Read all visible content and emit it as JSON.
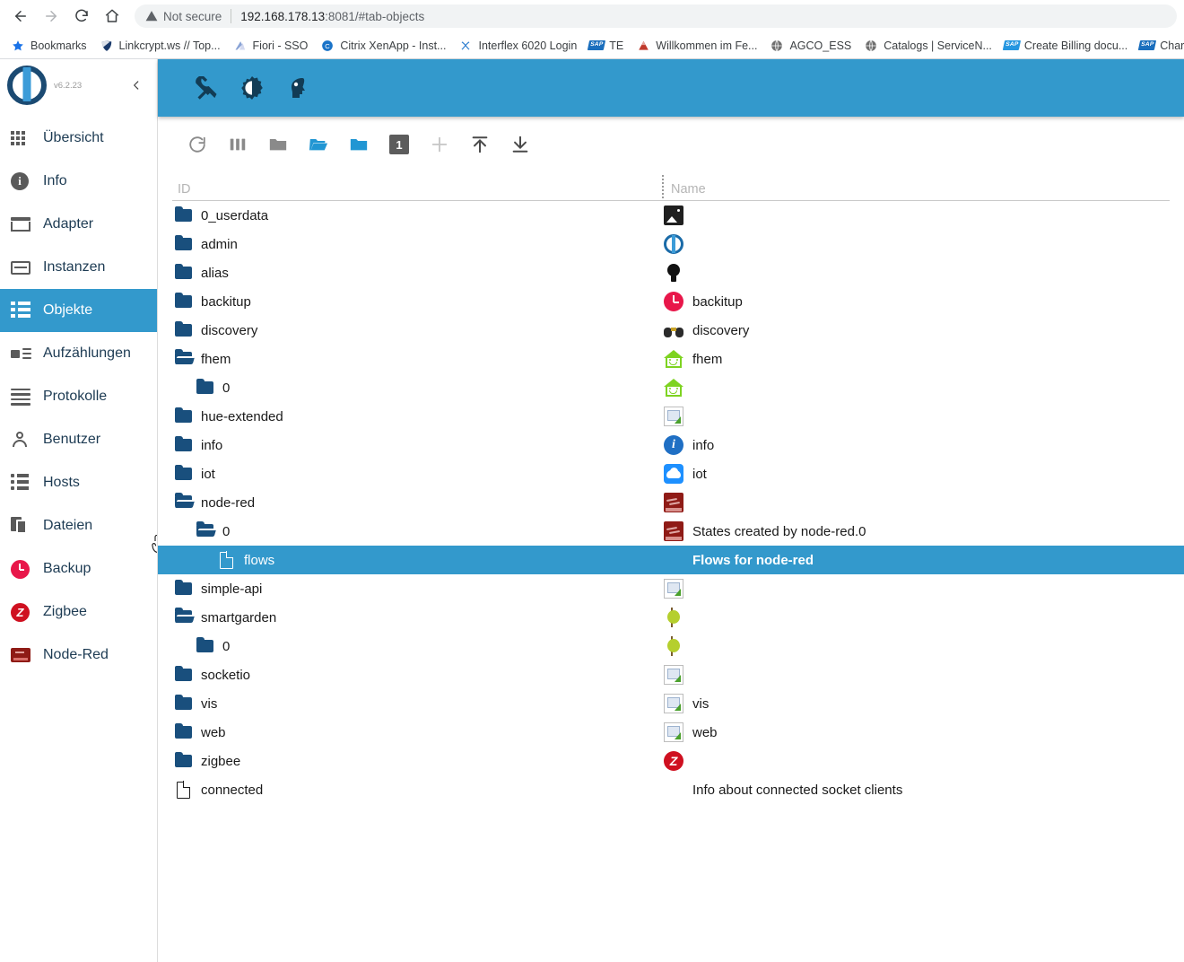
{
  "browser": {
    "nav": {
      "back": "←",
      "forward": "→",
      "reload": "↻",
      "home": "⌂"
    },
    "security_label": "Not secure",
    "url_host": "192.168.178.13",
    "url_rest": ":8081/#tab-objects",
    "bookmarks": [
      {
        "label": "Bookmarks",
        "icon": "star-icon"
      },
      {
        "label": "Linkcrypt.ws // Top...",
        "icon": "shield-icon"
      },
      {
        "label": "Fiori - SSO",
        "icon": "fiori-icon"
      },
      {
        "label": "Citrix XenApp - Inst...",
        "icon": "citrix-icon"
      },
      {
        "label": "Interflex 6020 Login",
        "icon": "interflex-icon"
      },
      {
        "label": "TE",
        "icon": "sap-icon"
      },
      {
        "label": "Willkommen im Fe...",
        "icon": "mountain-icon"
      },
      {
        "label": "AGCO_ESS",
        "icon": "globe-icon"
      },
      {
        "label": "Catalogs | ServiceN...",
        "icon": "globe-icon"
      },
      {
        "label": "Create Billing docu...",
        "icon": "sap-icon"
      },
      {
        "label": "Charm Lo",
        "icon": "sap-icon"
      }
    ]
  },
  "sidebar": {
    "version": "v6.2.23",
    "collapse_icon": "chevron-left-icon",
    "items": [
      {
        "label": "Übersicht",
        "icon": "grid-icon",
        "active": false
      },
      {
        "label": "Info",
        "icon": "info-icon",
        "active": false
      },
      {
        "label": "Adapter",
        "icon": "store-icon",
        "active": false
      },
      {
        "label": "Instanzen",
        "icon": "instance-icon",
        "active": false
      },
      {
        "label": "Objekte",
        "icon": "list-icon",
        "active": true
      },
      {
        "label": "Aufzählungen",
        "icon": "enum-icon",
        "active": false
      },
      {
        "label": "Protokolle",
        "icon": "log-icon",
        "active": false
      },
      {
        "label": "Benutzer",
        "icon": "user-icon",
        "active": false
      },
      {
        "label": "Hosts",
        "icon": "hosts-icon",
        "active": false
      },
      {
        "label": "Dateien",
        "icon": "files-icon",
        "active": false
      },
      {
        "label": "Backup",
        "icon": "backup-icon",
        "active": false
      },
      {
        "label": "Zigbee",
        "icon": "zigbee-icon",
        "active": false
      },
      {
        "label": "Node-Red",
        "icon": "nodered-icon",
        "active": false
      }
    ]
  },
  "app_header": {
    "background": "#3399cc",
    "icons": [
      {
        "name": "wrench-icon"
      },
      {
        "name": "contrast-icon"
      },
      {
        "name": "user-head-icon"
      }
    ]
  },
  "toolbar": {
    "buttons": [
      {
        "name": "refresh-icon",
        "title": "Refresh"
      },
      {
        "name": "columns-icon",
        "title": "Columns"
      },
      {
        "name": "collapse-all-icon",
        "title": "Collapse all"
      },
      {
        "name": "expand-all-icon",
        "title": "Expand all"
      },
      {
        "name": "expand-one-icon",
        "title": "Expand one level"
      },
      {
        "name": "depth-1-icon",
        "title": "1"
      },
      {
        "name": "add-object-icon",
        "title": "Add"
      },
      {
        "name": "import-icon",
        "title": "Import"
      },
      {
        "name": "export-icon",
        "title": "Export"
      }
    ],
    "depth_badge": "1"
  },
  "table": {
    "columns": [
      {
        "key": "id",
        "label": "ID"
      },
      {
        "key": "name",
        "label": "Name"
      }
    ],
    "rows": [
      {
        "id": "0_userdata",
        "indent": 0,
        "type": "folder-closed",
        "name": "",
        "name_icon": "image-icon",
        "selected": false
      },
      {
        "id": "admin",
        "indent": 0,
        "type": "folder-closed",
        "name": "",
        "name_icon": "iobroker-icon",
        "selected": false
      },
      {
        "id": "alias",
        "indent": 0,
        "type": "folder-closed",
        "name": "",
        "name_icon": "bulb-icon",
        "selected": false
      },
      {
        "id": "backitup",
        "indent": 0,
        "type": "folder-closed",
        "name": "backitup",
        "name_icon": "backup-icon",
        "selected": false
      },
      {
        "id": "discovery",
        "indent": 0,
        "type": "folder-closed",
        "name": "discovery",
        "name_icon": "binocular-icon",
        "selected": false
      },
      {
        "id": "fhem",
        "indent": 0,
        "type": "folder-open",
        "name": "fhem",
        "name_icon": "fhem-icon",
        "selected": false
      },
      {
        "id": "0",
        "indent": 1,
        "type": "folder-closed",
        "name": "",
        "name_icon": "fhem-icon",
        "selected": false
      },
      {
        "id": "hue-extended",
        "indent": 0,
        "type": "folder-closed",
        "name": "",
        "name_icon": "broken-icon",
        "selected": false
      },
      {
        "id": "info",
        "indent": 0,
        "type": "folder-closed",
        "name": "info",
        "name_icon": "info-blue-icon",
        "selected": false
      },
      {
        "id": "iot",
        "indent": 0,
        "type": "folder-closed",
        "name": "iot",
        "name_icon": "cloud-icon",
        "selected": false
      },
      {
        "id": "node-red",
        "indent": 0,
        "type": "folder-open",
        "name": "",
        "name_icon": "nodered-icon",
        "selected": false
      },
      {
        "id": "0",
        "indent": 1,
        "type": "folder-open",
        "name": "States created by node-red.0",
        "name_icon": "nodered-icon",
        "selected": false
      },
      {
        "id": "flows",
        "indent": 2,
        "type": "document",
        "name": "Flows for node-red",
        "name_icon": "none",
        "selected": true
      },
      {
        "id": "simple-api",
        "indent": 0,
        "type": "folder-closed",
        "name": "",
        "name_icon": "broken-icon",
        "selected": false
      },
      {
        "id": "smartgarden",
        "indent": 0,
        "type": "folder-open",
        "name": "",
        "name_icon": "leaf-icon",
        "selected": false
      },
      {
        "id": "0",
        "indent": 1,
        "type": "folder-closed",
        "name": "",
        "name_icon": "leaf-icon",
        "selected": false
      },
      {
        "id": "socketio",
        "indent": 0,
        "type": "folder-closed",
        "name": "",
        "name_icon": "broken-icon",
        "selected": false
      },
      {
        "id": "vis",
        "indent": 0,
        "type": "folder-closed",
        "name": "vis",
        "name_icon": "broken-icon",
        "selected": false
      },
      {
        "id": "web",
        "indent": 0,
        "type": "folder-closed",
        "name": "web",
        "name_icon": "broken-icon",
        "selected": false
      },
      {
        "id": "zigbee",
        "indent": 0,
        "type": "folder-closed",
        "name": "",
        "name_icon": "zigbee-icon",
        "selected": false
      },
      {
        "id": "connected",
        "indent": 0,
        "type": "document",
        "name": "Info about connected socket clients",
        "name_icon": "none",
        "selected": false
      }
    ]
  },
  "colors": {
    "accent": "#3399cc",
    "folder": "#194f7d",
    "selected_row": "#3399cc",
    "sidebar_text": "#1d3b53"
  }
}
